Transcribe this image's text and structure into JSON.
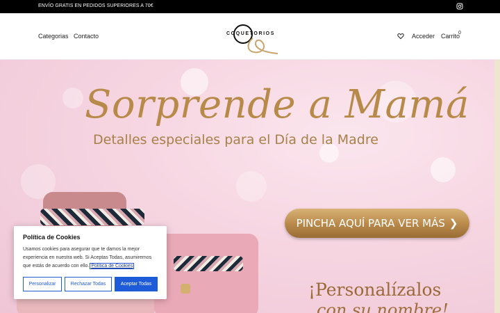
{
  "topbar": {
    "promo": "ENVÍO GRATIS EN PEDIDOS SUPERIORES A 70€",
    "social_icon": "instagram-icon"
  },
  "header": {
    "nav": [
      "Categorias",
      "Contacto"
    ],
    "logo_text": "COQUETORIOS",
    "login": "Acceder",
    "cart": "Carrito",
    "cart_count": "0",
    "colors": {
      "logo_gold": "#c9a36a"
    }
  },
  "hero": {
    "title": "Sorprende a Mamá",
    "subtitle": "Detalles especiales para el Día de la Madre",
    "cta": "PINCHA AQUÍ PARA VER MÁS",
    "personalize_line1": "¡Personalízalos",
    "personalize_line2": "con su nombre!",
    "colors": {
      "gold": "#b88a4a",
      "pink_bg": "#f6d5e1"
    }
  },
  "cookie_banner": {
    "title": "Política de Cookies",
    "text": "Usamos cookies para asegurar que te damos la mejor experiencia en nuestra web. Si Aceptas Todas, asumiremos que estás de acuerdo con ello.",
    "link": "Política de Cookies",
    "buttons": {
      "customize": "Personalizar",
      "reject": "Rechazar Todas",
      "accept": "Aceptar Todas"
    },
    "colors": {
      "primary": "#1e5bd8"
    }
  }
}
